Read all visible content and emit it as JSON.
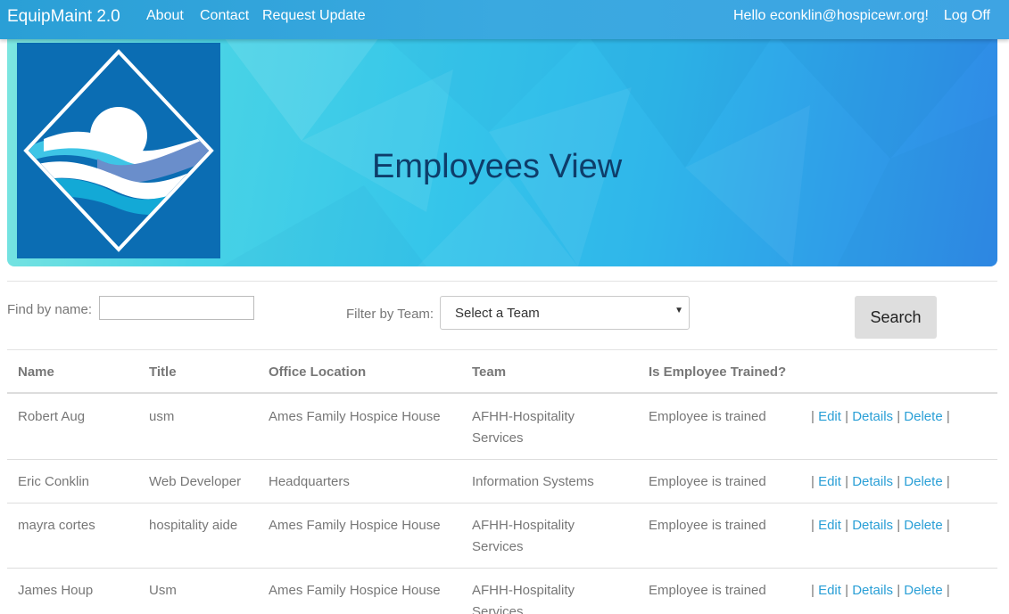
{
  "nav": {
    "brand": "EquipMaint 2.0",
    "links": [
      "About",
      "Contact",
      "Request Update"
    ],
    "greeting": "Hello econklin@hospicewr.org!",
    "logoff": "Log Off"
  },
  "banner": {
    "title": "Employees View",
    "logo_icon": "hospice-logo-sun-waves-icon"
  },
  "filters": {
    "find_label": "Find by name:",
    "find_value": "",
    "team_label": "Filter by Team:",
    "team_selected": "Select a Team",
    "search_label": "Search"
  },
  "table": {
    "headers": [
      "Name",
      "Title",
      "Office Location",
      "Team",
      "Is Employee Trained?"
    ],
    "rows": [
      {
        "name": "Robert Aug",
        "title": "usm",
        "office": "Ames Family Hospice House",
        "team": "AFHH-Hospitality Services",
        "trained": "Employee is trained"
      },
      {
        "name": "Eric Conklin",
        "title": "Web Developer",
        "office": "Headquarters",
        "team": "Information Systems",
        "trained": "Employee is trained"
      },
      {
        "name": "mayra cortes",
        "title": "hospitality aide",
        "office": "Ames Family Hospice House",
        "team": "AFHH-Hospitality Services",
        "trained": "Employee is trained"
      },
      {
        "name": "James Houp",
        "title": "Usm",
        "office": "Ames Family Hospice House",
        "team": "AFHH-Hospitality Services",
        "trained": "Employee is trained"
      }
    ],
    "actions": {
      "edit": "Edit",
      "details": "Details",
      "delete": "Delete",
      "sep": "|"
    }
  },
  "colors": {
    "navbar": "#2a9fd6",
    "link": "#2a9fd6",
    "banner_title": "#0e3d6a"
  }
}
